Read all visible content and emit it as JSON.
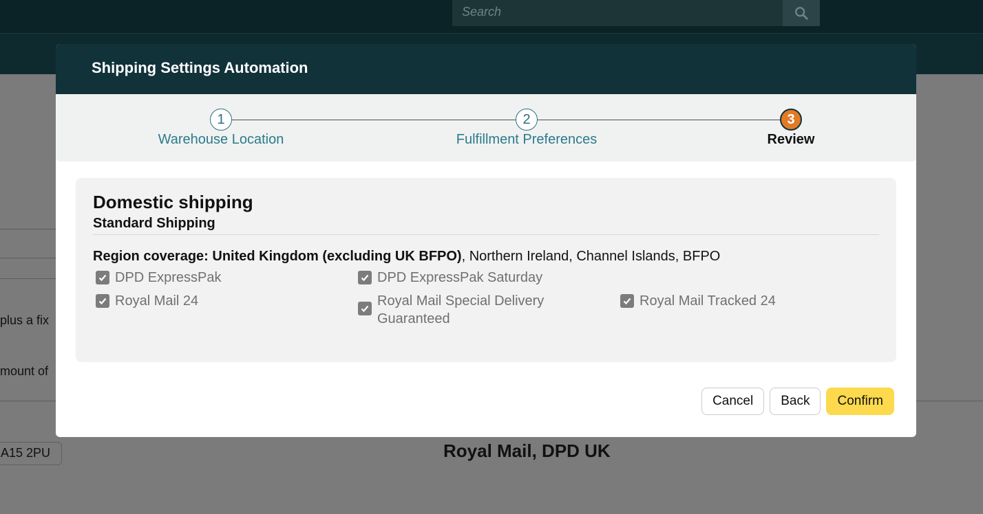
{
  "background": {
    "search_placeholder": "Search",
    "partial_text_1": "plus a fix",
    "partial_text_2": "mount of",
    "postcode_pill": "A15 2PU",
    "carriers": "Royal Mail, DPD UK"
  },
  "modal": {
    "title": "Shipping Settings Automation",
    "steps": [
      {
        "number": "1",
        "label": "Warehouse Location",
        "state": "completed"
      },
      {
        "number": "2",
        "label": "Fulfillment Preferences",
        "state": "completed"
      },
      {
        "number": "3",
        "label": "Review",
        "state": "active"
      }
    ],
    "card": {
      "title": "Domestic shipping",
      "subtitle": "Standard Shipping",
      "region_label": "Region coverage: United Kingdom (excluding UK BFPO)",
      "region_rest": ", Northern Ireland, Channel Islands, BFPO",
      "options": [
        {
          "label": "DPD ExpressPak",
          "checked": true
        },
        {
          "label": "DPD ExpressPak Saturday",
          "checked": true
        },
        {
          "label": "",
          "checked": false
        },
        {
          "label": "Royal Mail 24",
          "checked": true
        },
        {
          "label": "Royal Mail Special Delivery Guaranteed",
          "checked": true
        },
        {
          "label": "Royal Mail Tracked 24",
          "checked": true
        }
      ]
    },
    "buttons": {
      "cancel": "Cancel",
      "back": "Back",
      "confirm": "Confirm"
    }
  },
  "colors": {
    "header_bg": "#12323a",
    "active_step": "#e07b26",
    "step_link": "#2b7a8b",
    "confirm_bg": "#fcd94d"
  }
}
